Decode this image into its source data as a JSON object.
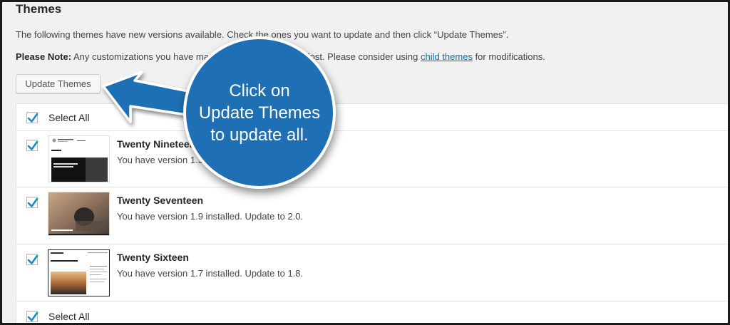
{
  "page": {
    "heading": "Themes",
    "intro": "The following themes have new versions available. Check the ones you want to update and then click “Update Themes”.",
    "note_label": "Please Note:",
    "note_text_before": " Any customizations you have made to theme files will be lost. Please consider using ",
    "note_link": "child themes",
    "note_text_after": " for modifications.",
    "update_button": "Update Themes"
  },
  "table": {
    "select_all_top": "Select All",
    "select_all_bottom": "Select All",
    "themes": [
      {
        "name": "Twenty Nineteen",
        "version_text": "You have version 1.3 installed. Update to 1.4.",
        "checked": true
      },
      {
        "name": "Twenty Seventeen",
        "version_text": "You have version 1.9 installed. Update to 2.0.",
        "checked": true
      },
      {
        "name": "Twenty Sixteen",
        "version_text": "You have version 1.7 installed. Update to 1.8.",
        "checked": true
      }
    ]
  },
  "callout": {
    "line1": "Click on",
    "line2": "Update Themes",
    "line3": "to update all.",
    "color": "#1e6fb3"
  },
  "thumbs": {
    "t19_title": "Placeholder",
    "t19_text": "Digital strategy for unique small businesses",
    "t16_text": "Come full moon with me"
  },
  "colors": {
    "link": "#0073aa",
    "checkmark": "#1e8cbe",
    "background": "#f1f1f1"
  }
}
